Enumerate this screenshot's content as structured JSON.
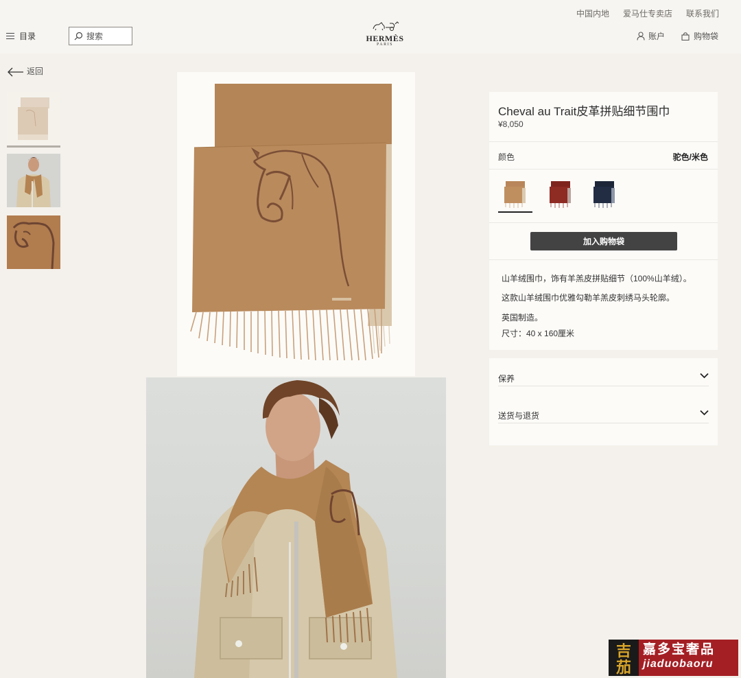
{
  "header": {
    "top_links": [
      "中国内地",
      "爱马仕专卖店",
      "联系我们"
    ],
    "menu_label": "目录",
    "search_placeholder": "搜索",
    "logo_name": "HERMÈS",
    "logo_sub": "PARIS",
    "account_label": "账户",
    "bag_label": "购物袋"
  },
  "nav": {
    "back_label": "返回"
  },
  "thumbnails": [
    {
      "name": "scarf-flat",
      "selected": true
    },
    {
      "name": "model-wearing-scarf",
      "selected": false
    },
    {
      "name": "horse-detail",
      "selected": false
    }
  ],
  "product": {
    "title": "Cheval au Trait皮革拼贴细节围巾",
    "price": "¥8,050",
    "color_label": "颜色",
    "color_value": "驼色/米色",
    "swatches": [
      {
        "name": "camel",
        "color": "#b8865a",
        "selected": true
      },
      {
        "name": "red",
        "color": "#8a2a22",
        "selected": false
      },
      {
        "name": "navy",
        "color": "#1f2a40",
        "selected": false
      }
    ],
    "add_to_bag_label": "加入购物袋",
    "description": [
      "山羊绒围巾，饰有羊羔皮拼贴细节（100%山羊绒）。",
      "这款山羊绒围巾优雅勾勒羊羔皮刺绣马头轮廓。",
      "英国制造。",
      "尺寸：40 x 160厘米"
    ]
  },
  "accordion": [
    {
      "label": "保养"
    },
    {
      "label": "送货与退货"
    }
  ],
  "watermark": {
    "logo_char_top": "吉",
    "logo_char_bottom": "茄",
    "cn": "嘉多宝奢品",
    "en": "jiaduobaoru"
  },
  "colors": {
    "background": "#f4f1ec",
    "panel": "#fcfbf8",
    "button": "#434343",
    "scarf_camel": "#b8865a"
  }
}
